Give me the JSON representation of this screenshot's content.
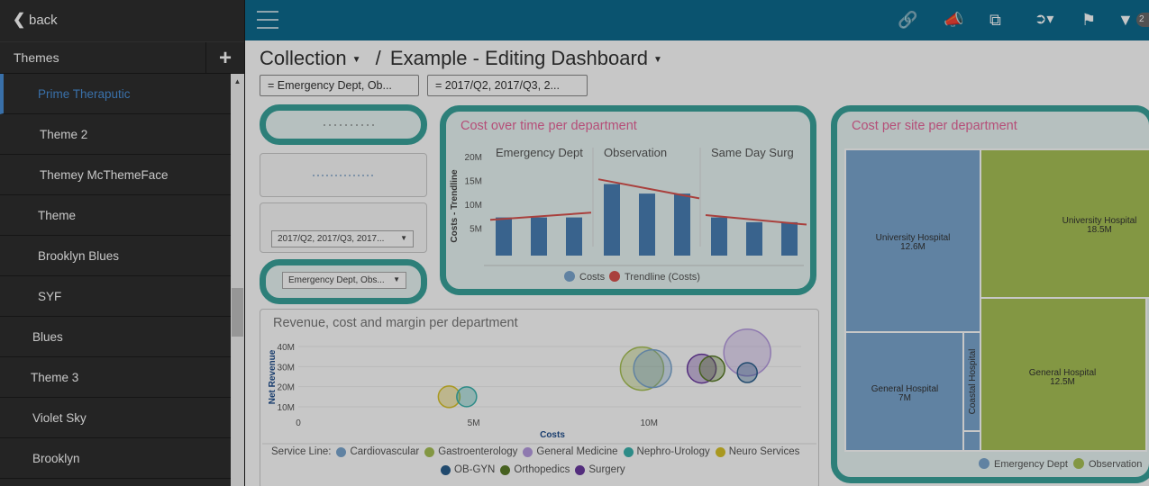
{
  "sidebar": {
    "back_label": "back",
    "themes_header": "Themes",
    "add_label": "+",
    "items": [
      {
        "label": "Prime Theraputic",
        "active": true
      },
      {
        "label": "Theme 2"
      },
      {
        "label": "Themey McThemeFace"
      },
      {
        "label": "Theme"
      },
      {
        "label": "Brooklyn Blues"
      },
      {
        "label": "SYF"
      },
      {
        "label": "Blues"
      },
      {
        "label": "Theme 3"
      },
      {
        "label": "Violet Sky"
      },
      {
        "label": "Brooklyn"
      }
    ]
  },
  "topbar": {
    "menu_icon": "hamburger-icon",
    "filter_count": "2"
  },
  "breadcrumb": {
    "collection": "Collection",
    "separator": "/",
    "dashboard": "Example - Editing Dashboard"
  },
  "filters": [
    "= Emergency Dept, Ob...",
    "= 2017/Q2, 2017/Q3, 2..."
  ],
  "tiles": {
    "period_dropdown": "2017/Q2, 2017/Q3, 2017...",
    "dept_dropdown": "Emergency Dept, Obs..."
  },
  "cost_over_time": {
    "title": "Cost over time per department",
    "legend": [
      "Costs",
      "Trendline (Costs)"
    ]
  },
  "cost_per_site": {
    "title": "Cost per site per department",
    "legend": [
      "Emergency Dept",
      "Observation"
    ]
  },
  "revenue_chart": {
    "title": "Revenue, cost and margin per department",
    "legend_title": "Service Line:",
    "legend": [
      "Cardiovascular",
      "Gastroenterology",
      "General Medicine",
      "Nephro-Urology",
      "Neuro Services",
      "OB-GYN",
      "Orthopedics",
      "Surgery"
    ]
  },
  "colors": {
    "topbar": "#0d6b8f",
    "teal_border": "#3aa39c",
    "title_pink": "#e8659a",
    "bar_blue": "#4a7fb5",
    "trend_red": "#d9534f",
    "treemap_blue": "#7ba7d0",
    "treemap_green": "#a8c256"
  },
  "chart_data": [
    {
      "type": "bar",
      "title": "Cost over time per department",
      "ylabel": "Costs - Trendline",
      "ylim": [
        0,
        20
      ],
      "y_ticks": [
        "20M",
        "15M",
        "10M",
        "5M"
      ],
      "panels": [
        {
          "name": "Emergency Dept",
          "values": [
            8,
            8,
            8
          ],
          "trend": [
            7.5,
            9
          ]
        },
        {
          "name": "Observation",
          "values": [
            15,
            13,
            13
          ],
          "trend": [
            16,
            12
          ]
        },
        {
          "name": "Same Day Surg",
          "values": [
            8,
            7,
            7
          ],
          "trend": [
            8.5,
            6.5
          ]
        }
      ],
      "legend": [
        "Costs",
        "Trendline (Costs)"
      ]
    },
    {
      "type": "heatmap",
      "title": "Cost per site per department",
      "series": [
        {
          "name": "Emergency Dept",
          "cells": [
            {
              "label": "University Hospital",
              "value": "12.6M"
            },
            {
              "label": "General Hospital",
              "value": "7M"
            },
            {
              "label": "Coastal Hospital",
              "value": ""
            }
          ]
        },
        {
          "name": "Observation",
          "cells": [
            {
              "label": "University Hospital",
              "value": "18.5M"
            },
            {
              "label": "General Hospital",
              "value": "12.5M"
            }
          ]
        }
      ]
    },
    {
      "type": "scatter",
      "title": "Revenue, cost and margin per department",
      "xlabel": "Costs",
      "ylabel": "Net Revenue",
      "x_ticks": [
        "0",
        "5M",
        "10M"
      ],
      "y_ticks": [
        "40M",
        "30M",
        "20M",
        "10M"
      ],
      "xlim": [
        0,
        13
      ],
      "ylim": [
        5,
        40
      ],
      "series": [
        {
          "name": "Neuro Services",
          "points": [
            {
              "x": 4.3,
              "y": 15,
              "size": 12
            }
          ]
        },
        {
          "name": "Nephro-Urology",
          "points": [
            {
              "x": 4.8,
              "y": 15,
              "size": 11
            }
          ]
        },
        {
          "name": "Gastroenterology",
          "points": [
            {
              "x": 9.8,
              "y": 29,
              "size": 24
            }
          ]
        },
        {
          "name": "Cardiovascular",
          "points": [
            {
              "x": 10.1,
              "y": 29,
              "size": 21
            }
          ]
        },
        {
          "name": "Surgery",
          "points": [
            {
              "x": 11.5,
              "y": 29,
              "size": 16
            }
          ]
        },
        {
          "name": "Orthopedics",
          "points": [
            {
              "x": 11.8,
              "y": 29,
              "size": 14
            }
          ]
        },
        {
          "name": "General Medicine",
          "points": [
            {
              "x": 12.8,
              "y": 37,
              "size": 26
            }
          ]
        },
        {
          "name": "OB-GYN",
          "points": [
            {
              "x": 12.8,
              "y": 27,
              "size": 11
            }
          ]
        }
      ]
    }
  ]
}
